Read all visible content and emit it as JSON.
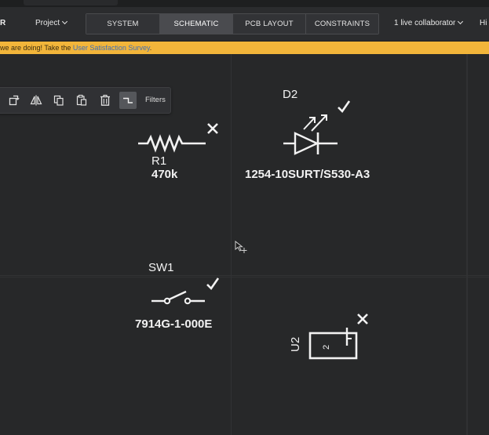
{
  "header": {
    "brand": "R",
    "project_menu": "Project",
    "tabs": [
      {
        "label": "SYSTEM",
        "active": false
      },
      {
        "label": "SCHEMATIC",
        "active": true
      },
      {
        "label": "PCB LAYOUT",
        "active": false
      },
      {
        "label": "CONSTRAINTS",
        "active": false
      }
    ],
    "collaborators": "1 live collaborator",
    "help_partial": "Hi"
  },
  "banner": {
    "text_before": "we are doing! Take the ",
    "link_text": "User Satisfaction Survey",
    "text_after": ".",
    "background": "#f2b53a"
  },
  "toolbar": {
    "buttons": [
      {
        "name": "rotate",
        "icon": "rotate-icon"
      },
      {
        "name": "flip",
        "icon": "flip-horizontal-icon"
      },
      {
        "name": "copy",
        "icon": "copy-icon"
      },
      {
        "name": "paste",
        "icon": "paste-icon"
      },
      {
        "name": "delete",
        "icon": "trash-icon"
      },
      {
        "name": "wire",
        "icon": "wire-icon",
        "active": true
      }
    ],
    "filters_label": "Filters"
  },
  "schematic": {
    "components": [
      {
        "ref": "R1",
        "value": "470k",
        "symbol": "resistor",
        "status": "x-mark-icon"
      },
      {
        "ref": "D2",
        "value": "1254-10SURT/S530-A3",
        "symbol": "led",
        "status": "check-mark-icon"
      },
      {
        "ref": "SW1",
        "value": "7914G-1-000E",
        "symbol": "switch",
        "status": "check-mark-icon"
      },
      {
        "ref": "U2",
        "value": "",
        "pin_label": "2",
        "symbol": "ic-block",
        "status": "x-mark-icon"
      }
    ],
    "line_color": "#f2f2f2",
    "background": "#272829"
  }
}
